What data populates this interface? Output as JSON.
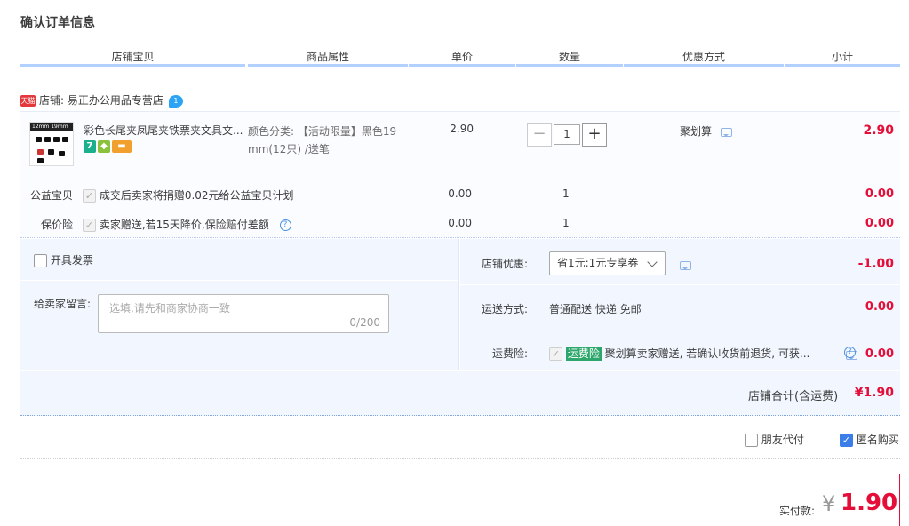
{
  "page": {
    "title": "确认订单信息"
  },
  "columns": [
    "店铺宝贝",
    "商品属性",
    "单价",
    "数量",
    "优惠方式",
    "小计"
  ],
  "shop": {
    "tmall_badge": "天猫",
    "label": "店铺: 易正办公用品专营店",
    "ww_badge": "1"
  },
  "item": {
    "name": "彩色长尾夹凤尾夹铁票夹文具文...",
    "attr_line1": "颜色分类: 【活动限量】黑色19",
    "attr_line2": "mm(12只) /送笔",
    "price": "2.90",
    "quantity": "1",
    "qty_minus": "−",
    "qty_plus": "+",
    "promo": "聚划算",
    "subtotal": "2.90",
    "thumb_text": "12mm 19mm",
    "badge_seven": "7"
  },
  "charity": {
    "label": "公益宝贝",
    "desc": "成交后卖家将捐赠0.02元给公益宝贝计划",
    "price": "0.00",
    "qty": "1",
    "subtotal": "0.00"
  },
  "insurance": {
    "label": "保价险",
    "desc": "卖家赠送,若15天降价,保险赔付差额",
    "price": "0.00",
    "qty": "1",
    "subtotal": "0.00",
    "help": "?"
  },
  "invoice": {
    "label": "开具发票"
  },
  "message": {
    "label": "给卖家留言:",
    "placeholder": "选填,请先和商家协商一致",
    "counter": "0/200"
  },
  "shop_discount": {
    "label": "店铺优惠:",
    "selected": "省1元:1元专享券",
    "amount": "-1.00"
  },
  "shipping": {
    "label": "运送方式:",
    "value": "普通配送 快递 免邮",
    "amount": "0.00"
  },
  "freight_insurance": {
    "label": "运费险:",
    "tag": "运费险",
    "desc": "聚划算卖家赠送, 若确认收货前退货, 可获...",
    "amount": "0.00",
    "help": "?"
  },
  "shop_total": {
    "label": "店铺合计(含运费)",
    "amount": "¥1.90"
  },
  "options": {
    "friend_pay": "朋友代付",
    "anonymous": "匿名购买"
  },
  "payment": {
    "label": "实付款:",
    "currency": "¥",
    "amount": "1.90"
  },
  "colors": {
    "accent_red": "#e40e38",
    "header_line": "#b2d1ff",
    "panel_bg": "#f2f7ff",
    "check_blue": "#3b7de9",
    "freight_tag": "#2ca66b"
  }
}
